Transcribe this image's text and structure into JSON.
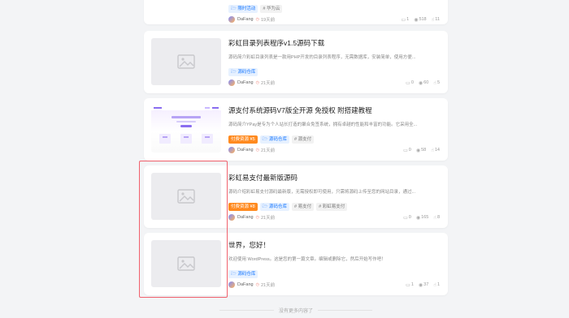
{
  "posts": [
    {
      "title": "",
      "excerpt": "",
      "tags": [
        {
          "label": "限时活动",
          "style": "blue",
          "icon": "folder-icon"
        },
        {
          "label": "# 华为云",
          "style": "gray"
        }
      ],
      "author": "DaFang",
      "time": "19天前",
      "comments": "1",
      "views": "518",
      "likes": "11",
      "thumb": "none"
    },
    {
      "title": "彩虹目录列表程序v1.5源码下载",
      "excerpt": "源码简介彩虹目录列表是一款用PHP开发的目录列表程序，无需数据库，安装简单，使用方便...",
      "tags": [
        {
          "label": "源码仓库",
          "style": "blue",
          "icon": "folder-icon"
        }
      ],
      "author": "DaFang",
      "time": "21天前",
      "comments": "0",
      "views": "60",
      "likes": "5",
      "thumb": "placeholder"
    },
    {
      "title": "源支付系统源码V7版全开源 免授权 附搭建教程",
      "excerpt": "源码简介YPay是专为个人站长打造的聚合免签系统，拥有卓越的性能和丰富的功能。它采用全...",
      "tags": [
        {
          "label": "付费资源 ¥5",
          "style": "orange"
        },
        {
          "label": "源码仓库",
          "style": "blue",
          "icon": "folder-icon"
        },
        {
          "label": "# 源支付",
          "style": "gray"
        }
      ],
      "author": "DaFang",
      "time": "21天前",
      "comments": "0",
      "views": "58",
      "likes": "14",
      "thumb": "screenshot"
    },
    {
      "title": "彩虹易支付最新版源码",
      "excerpt": "源码介绍彩虹易支付源码最新版，无需授权即可使用，只需将源码上传至您的网站目录，通过...",
      "tags": [
        {
          "label": "付费资源 ¥8",
          "style": "orange"
        },
        {
          "label": "源码仓库",
          "style": "blue",
          "icon": "folder-icon"
        },
        {
          "label": "# 易支付",
          "style": "gray"
        },
        {
          "label": "# 彩虹易支付",
          "style": "gray"
        }
      ],
      "author": "DaFang",
      "time": "21天前",
      "comments": "0",
      "views": "165",
      "likes": "8",
      "thumb": "placeholder"
    },
    {
      "title": "世界，您好！",
      "excerpt": "欢迎使用 WordPress。这是您的第一篇文章。编辑或删除它，然后开始写作吧！",
      "tags": [
        {
          "label": "源码仓库",
          "style": "blue",
          "icon": "folder-icon"
        }
      ],
      "author": "DaFang",
      "time": "21天前",
      "comments": "1",
      "views": "37",
      "likes": "1",
      "thumb": "placeholder"
    }
  ],
  "end_note": "没有更多内容了",
  "colors": {
    "highlight": "#f0616d",
    "tag_blue": "#1677ff",
    "tag_orange": "#ff8a1f"
  },
  "icons": {
    "comments": "comment-icon",
    "views": "eye-icon",
    "likes": "thumb-up-icon",
    "time": "clock-icon",
    "thumb": "image-placeholder-icon"
  }
}
